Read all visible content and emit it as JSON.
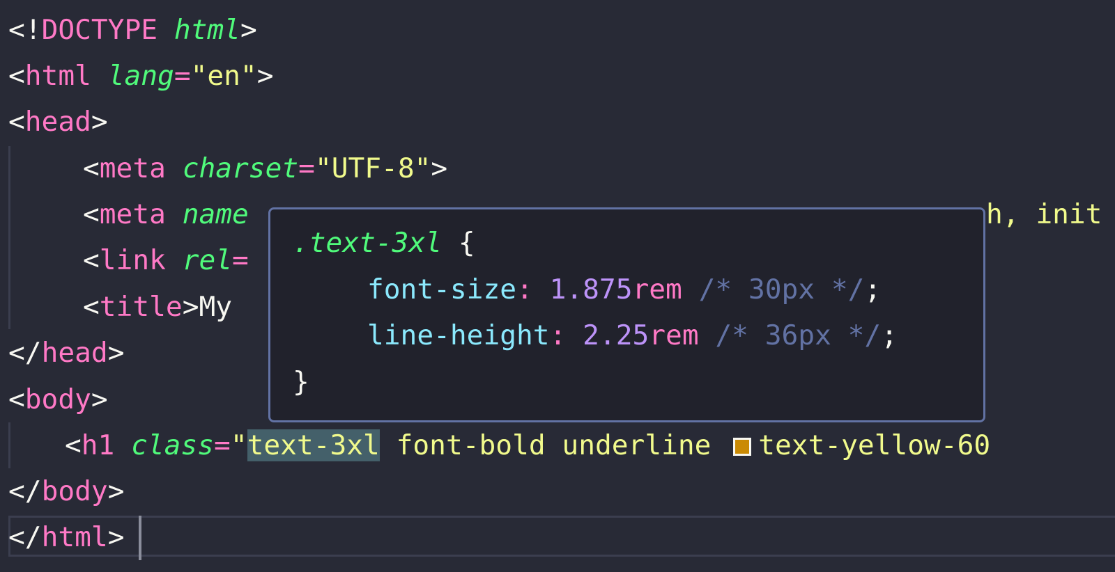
{
  "editor": {
    "lines": [
      {
        "l1_a": "<!",
        "l1_b": "DOCTYPE",
        "l1_c": " ",
        "l1_d": "html",
        "l1_e": ">"
      },
      {}
    ],
    "line1": {
      "open": "<!",
      "keyword": "DOCTYPE",
      "attr": "html",
      "close": ">"
    },
    "line2": {
      "open": "<",
      "tag": "html",
      "attr": "lang",
      "eq": "=",
      "value": "\"en\"",
      "close": ">"
    },
    "line3": {
      "open": "<",
      "tag": "head",
      "close": ">"
    },
    "line4": {
      "open": "<",
      "tag": "meta",
      "attr": "charset",
      "eq": "=",
      "value": "\"UTF-8\"",
      "close": ">"
    },
    "line5": {
      "open": "<",
      "tag": "meta",
      "attr": "name",
      "tail": "h, init"
    },
    "line6": {
      "open": "<",
      "tag": "link",
      "attr": "rel",
      "eq": "="
    },
    "line7": {
      "open": "<",
      "tag": "title",
      "close": ">",
      "text": "My"
    },
    "line8": {
      "open": "</",
      "tag": "head",
      "close": ">"
    },
    "line9": {
      "open": "<",
      "tag": "body",
      "close": ">"
    },
    "line10": {
      "open": "<",
      "tag": "h1",
      "attr": "class",
      "eq": "=",
      "quote": "\"",
      "class_hover": "text-3xl",
      "class_rest": " font-bold underline",
      "class_color": "text-yellow-60",
      "swatch_color": "#ca8a04"
    },
    "line11": {
      "open": "</",
      "tag": "body",
      "close": ">"
    },
    "line12": {
      "open": "</",
      "tag": "html",
      "close": ">"
    }
  },
  "hover": {
    "selector": ".text-3xl",
    "open_brace": "{",
    "decl1": {
      "prop": "font-size",
      "colon": ":",
      "num": "1.875",
      "unit": "rem",
      "comment": "/* 30px */",
      "semi": ";"
    },
    "decl2": {
      "prop": "line-height",
      "colon": ":",
      "num": "2.25",
      "unit": "rem",
      "comment": "/* 36px */",
      "semi": ";"
    },
    "close_brace": "}"
  }
}
